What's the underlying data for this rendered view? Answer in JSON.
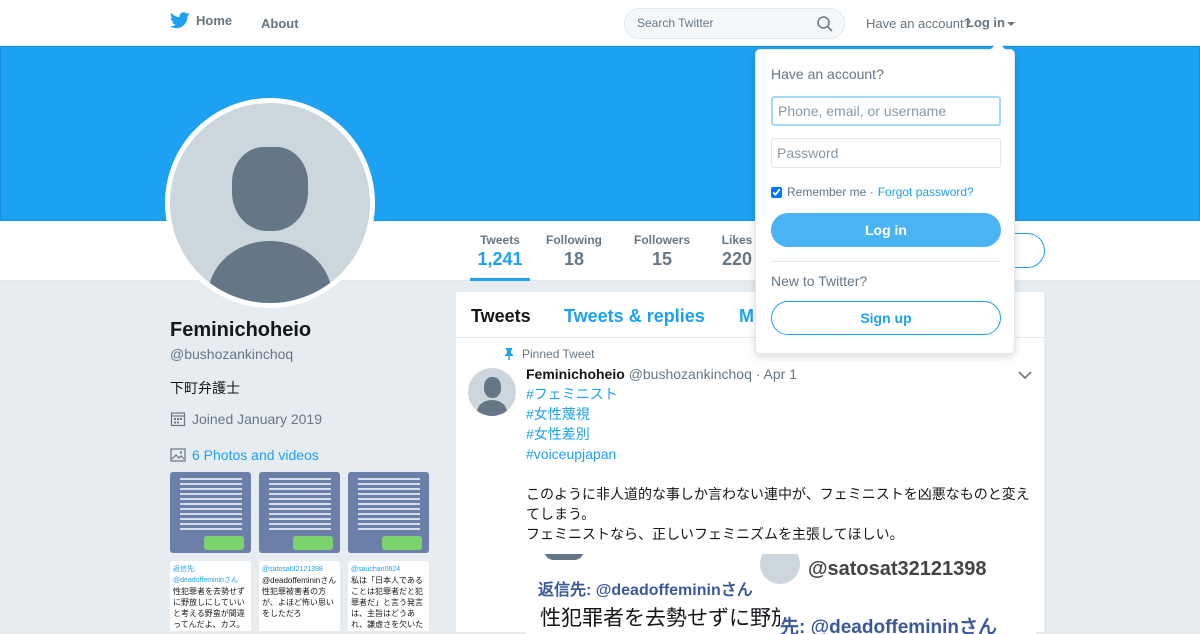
{
  "nav": {
    "home_label": "Home",
    "about_label": "About",
    "search_placeholder": "Search Twitter",
    "have_account": "Have an account?",
    "login_label": "Log in"
  },
  "colors": {
    "accent": "#1da1f2",
    "banner": "#1da1f2",
    "login_button": "#4ab3f4"
  },
  "profile": {
    "name": "Feminichoheio",
    "handle": "@bushozankinchoq",
    "bio": "下町弁護士",
    "joined": "Joined January 2019",
    "photos_link": "6 Photos and videos"
  },
  "stats": [
    {
      "label": "Tweets",
      "value": "1,241"
    },
    {
      "label": "Following",
      "value": "18"
    },
    {
      "label": "Followers",
      "value": "15"
    },
    {
      "label": "Likes",
      "value": "220"
    }
  ],
  "media_thumbs": {
    "row2": [
      {
        "head": "返信先: @deadoffemininさん",
        "text": "性犯罪者を去勢せずに野放しにしていいと考える野蛮が間違ってんだよ、カス。新たな被害者を出さない為と、範囲の為だろうが。"
      },
      {
        "head": "@satosat32121398",
        "text": "@deadoffemininさん 性犯罪被害者の方が、よほど怖い思いをしただろ"
      },
      {
        "head": "@sauchan0624",
        "text": "私は「日本人であることは犯罪者だと犯罪者だ」と言う発言は、主旨はどうあれ、謙虚さを欠いた発言と思います。ただし、この発言について"
      }
    ]
  },
  "timeline": {
    "tabs": [
      "Tweets",
      "Tweets & replies",
      "M"
    ],
    "pinned_label": "Pinned Tweet",
    "tweet": {
      "name": "Feminichoheio",
      "handle": "@bushozankinchoq",
      "date": "· Apr 1",
      "hashtags": [
        "#フェミニスト",
        "#女性蔑視",
        "#女性差別",
        "#voiceupjapan"
      ],
      "text1": "このように非人道的な事しか言わない連中が、フェミニストを凶悪なものと変えてしまう。",
      "text2": "フェミニストなら、正しいフェミニズムを主張してほしい。",
      "media_left_head": "返信先: @deadoffemininさん",
      "media_left_text": "性犯罪者を去勢せずに野放",
      "media_right_handle": "@satosat32121398",
      "media_right_reply": "先: @deadoffemininさん"
    }
  },
  "login_dropdown": {
    "title": "Have an account?",
    "username_placeholder": "Phone, email, or username",
    "password_placeholder": "Password",
    "remember_label": "Remember me ·",
    "forgot_label": "Forgot password?",
    "login_button": "Log in",
    "new_label": "New to Twitter?",
    "signup_button": "Sign up"
  }
}
